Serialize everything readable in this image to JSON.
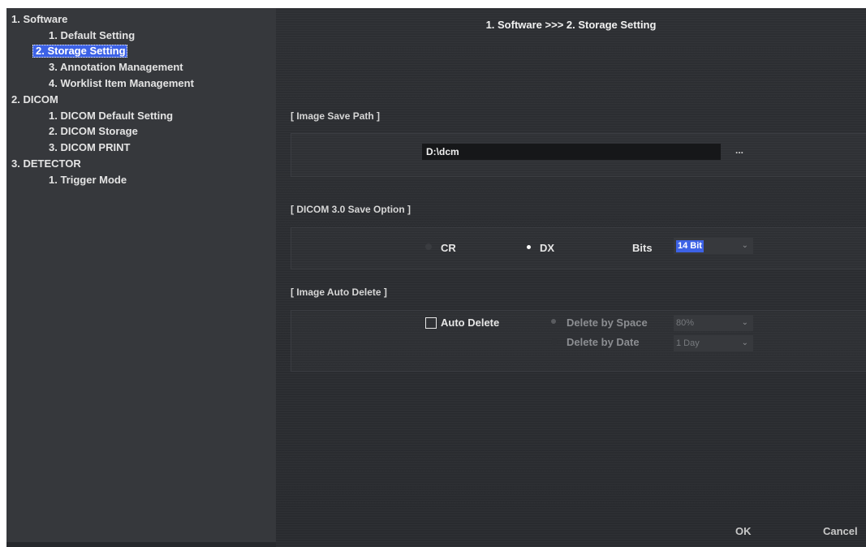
{
  "tree": [
    {
      "label": "1. Software"
    },
    {
      "label": "1. Default Setting"
    },
    {
      "label": "2. Storage Setting"
    },
    {
      "label": "3. Annotation Management"
    },
    {
      "label": "4. Worklist Item Management"
    },
    {
      "label": "2. DICOM"
    },
    {
      "label": "1. DICOM Default Setting"
    },
    {
      "label": "2. DICOM Storage"
    },
    {
      "label": "3. DICOM PRINT"
    },
    {
      "label": "3. DETECTOR"
    },
    {
      "label": "1. Trigger Mode"
    }
  ],
  "breadcrumb": "1. Software >>> 2. Storage Setting",
  "image_save_path": {
    "title": "[ Image Save Path ]",
    "value": "D:\\dcm",
    "browse_label": "..."
  },
  "dicom_save_option": {
    "title": "[ DICOM 3.0 Save Option ]",
    "option_cr": "CR",
    "option_dx": "DX",
    "selected": "DX",
    "bits_label": "Bits",
    "bits_value": "14 Bit"
  },
  "image_auto_delete": {
    "title": "[ Image Auto Delete ]",
    "auto_delete_label": "Auto Delete",
    "auto_delete_checked": false,
    "delete_by_space_label": "Delete by Space",
    "space_value": "80%",
    "delete_by_date_label": "Delete by Date",
    "date_value": "1 Day"
  },
  "buttons": {
    "ok": "OK",
    "cancel": "Cancel"
  },
  "colors": {
    "selection": "#3d62e6",
    "tree_background": "#36383c",
    "main_background": "#2b2d31"
  }
}
